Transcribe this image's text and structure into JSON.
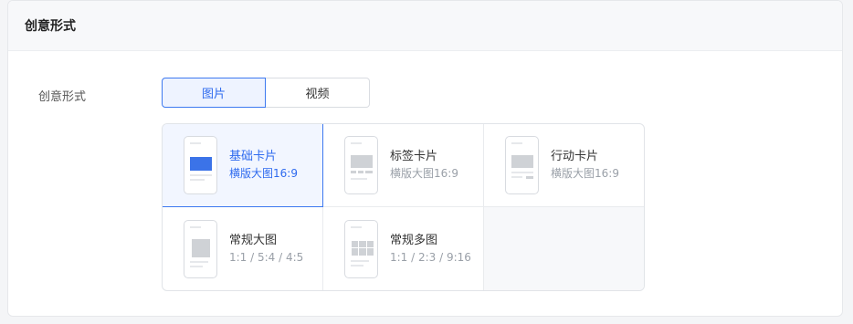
{
  "section": {
    "title": "创意形式"
  },
  "form": {
    "label": "创意形式",
    "tabs": [
      {
        "label": "图片",
        "active": true
      },
      {
        "label": "视频",
        "active": false
      }
    ],
    "options": [
      {
        "title": "基础卡片",
        "subtitle": "横版大图16:9",
        "selected": true,
        "icon": "basic-card-icon"
      },
      {
        "title": "标签卡片",
        "subtitle": "横版大图16:9",
        "selected": false,
        "icon": "tag-card-icon"
      },
      {
        "title": "行动卡片",
        "subtitle": "横版大图16:9",
        "selected": false,
        "icon": "action-card-icon"
      },
      {
        "title": "常规大图",
        "subtitle": "1:1 / 5:4 / 4:5",
        "selected": false,
        "icon": "large-image-icon"
      },
      {
        "title": "常规多图",
        "subtitle": "1:1 / 2:3 / 9:16",
        "selected": false,
        "icon": "multi-image-icon"
      }
    ]
  },
  "colors": {
    "accent": "#3d79f0",
    "accent_bg": "#f2f6ff",
    "muted": "#9aa0a8"
  }
}
